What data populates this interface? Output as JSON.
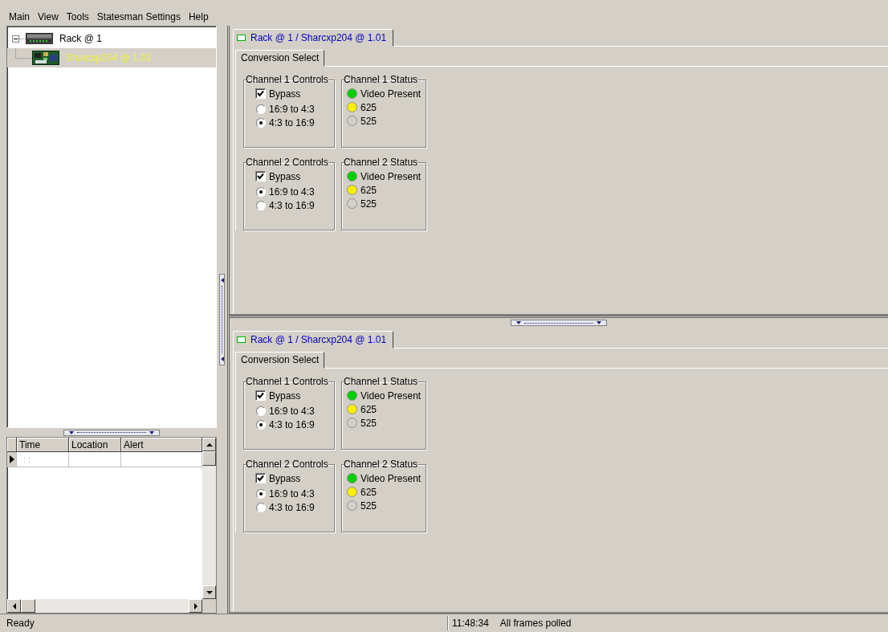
{
  "menu": [
    {
      "label": "Main"
    },
    {
      "label": "View"
    },
    {
      "label": "Tools"
    },
    {
      "label": "Statesman Settings"
    },
    {
      "label": "Help"
    }
  ],
  "tree": [
    {
      "label": "Rack @ 1",
      "kind": "rack",
      "expanded": true,
      "selected": false,
      "children": [
        {
          "label": "Sharcxp204 @ 1.01",
          "kind": "card",
          "selected": true
        }
      ]
    }
  ],
  "alerts": {
    "columns": [
      "Time",
      "Location",
      "Alert"
    ],
    "rows": [
      {
        "current": true,
        "time": ": :"
      }
    ]
  },
  "panes": [
    {
      "tab": {
        "label": "Rack @ 1 / Sharcxp204 @ 1.01",
        "selected": true
      },
      "subtabs": [
        {
          "label": "Conversion Select",
          "selected": true
        }
      ],
      "channels": [
        {
          "controls_title": "Channel 1 Controls",
          "bypass": {
            "label": "Bypass",
            "checked": true
          },
          "options": [
            {
              "label": "16:9 to 4:3",
              "selected": false
            },
            {
              "label": "4:3 to 16:9",
              "selected": true
            }
          ],
          "status_title": "Channel 1 Status",
          "indicators": [
            {
              "label": "Video Present",
              "color": "#00d000"
            },
            {
              "label": "625",
              "color": "#f8f000"
            },
            {
              "label": "525",
              "color": "#d4d0c8"
            }
          ]
        },
        {
          "controls_title": "Channel 2 Controls",
          "bypass": {
            "label": "Bypass",
            "checked": true
          },
          "options": [
            {
              "label": "16:9 to 4:3",
              "selected": true
            },
            {
              "label": "4:3 to 16:9",
              "selected": false
            }
          ],
          "status_title": "Channel 2 Status",
          "indicators": [
            {
              "label": "Video Present",
              "color": "#00d000"
            },
            {
              "label": "625",
              "color": "#f8f000"
            },
            {
              "label": "525",
              "color": "#d4d0c8"
            }
          ]
        }
      ]
    },
    {
      "tab": {
        "label": "Rack @ 1 / Sharcxp204 @ 1.01",
        "selected": true
      },
      "subtabs": [
        {
          "label": "Conversion Select",
          "selected": true
        }
      ],
      "channels": [
        {
          "controls_title": "Channel 1 Controls",
          "bypass": {
            "label": "Bypass",
            "checked": true
          },
          "options": [
            {
              "label": "16:9 to 4:3",
              "selected": false
            },
            {
              "label": "4:3 to 16:9",
              "selected": true
            }
          ],
          "status_title": "Channel 1 Status",
          "indicators": [
            {
              "label": "Video Present",
              "color": "#00d000"
            },
            {
              "label": "625",
              "color": "#f8f000"
            },
            {
              "label": "525",
              "color": "#d4d0c8"
            }
          ]
        },
        {
          "controls_title": "Channel 2 Controls",
          "bypass": {
            "label": "Bypass",
            "checked": true
          },
          "options": [
            {
              "label": "16:9 to 4:3",
              "selected": true
            },
            {
              "label": "4:3 to 16:9",
              "selected": false
            }
          ],
          "status_title": "Channel 2 Status",
          "indicators": [
            {
              "label": "Video Present",
              "color": "#00d000"
            },
            {
              "label": "625",
              "color": "#f8f000"
            },
            {
              "label": "525",
              "color": "#d4d0c8"
            }
          ]
        }
      ]
    }
  ],
  "status_bar": {
    "message": "Ready",
    "time": "11:48:34",
    "info": "All frames polled"
  }
}
